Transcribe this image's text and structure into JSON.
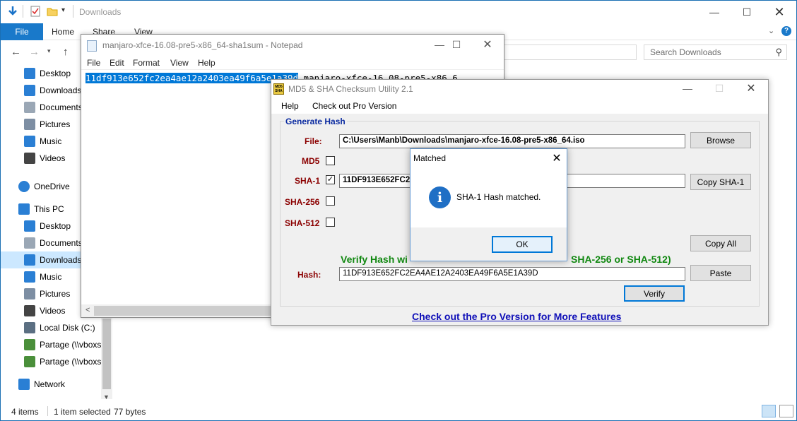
{
  "explorer": {
    "title": "Downloads",
    "ribbon_tabs": {
      "file": "File",
      "home": "Home",
      "share": "Share",
      "view": "View"
    },
    "search_placeholder": "Search Downloads",
    "quick_access": [
      {
        "label": "Desktop",
        "icon": "desktop-icon"
      },
      {
        "label": "Downloads",
        "icon": "download-icon"
      },
      {
        "label": "Documents",
        "icon": "documents-icon"
      },
      {
        "label": "Pictures",
        "icon": "pictures-icon"
      },
      {
        "label": "Music",
        "icon": "music-icon"
      },
      {
        "label": "Videos",
        "icon": "videos-icon"
      }
    ],
    "onedrive": "OneDrive",
    "this_pc": "This PC",
    "this_pc_items": [
      {
        "label": "Desktop",
        "icon": "desktop-icon"
      },
      {
        "label": "Documents",
        "icon": "documents-icon"
      },
      {
        "label": "Downloads",
        "icon": "download-icon",
        "selected": true
      },
      {
        "label": "Music",
        "icon": "music-icon"
      },
      {
        "label": "Pictures",
        "icon": "pictures-icon"
      },
      {
        "label": "Videos",
        "icon": "videos-icon"
      },
      {
        "label": "Local Disk (C:)",
        "icon": "drive-icon"
      },
      {
        "label": "Partage (\\\\vboxs",
        "icon": "network-drive-icon"
      },
      {
        "label": "Partage (\\\\vboxs",
        "icon": "network-drive-icon"
      }
    ],
    "network": "Network",
    "status": {
      "items": "4 items",
      "selected": "1 item selected",
      "size": "77 bytes"
    }
  },
  "notepad": {
    "title": "manjaro-xfce-16.08-pre5-x86_64-sha1sum - Notepad",
    "menu": [
      "File",
      "Edit",
      "Format",
      "View",
      "Help"
    ],
    "selected_text": "11df913e652fc2ea4ae12a2403ea49f6a5e1a39d",
    "rest_text": "  manjaro-xfce-16.08-pre5-x86_6"
  },
  "md5util": {
    "title": "MD5 & SHA Checksum Utility 2.1",
    "logo_text": "MD5 SHA",
    "menu": [
      "Help",
      "Check out Pro Version"
    ],
    "generate_legend": "Generate Hash",
    "file_label": "File:",
    "file_value": "C:\\Users\\Manb\\Downloads\\manjaro-xfce-16.08-pre5-x86_64.iso",
    "browse": "Browse",
    "md5_label": "MD5",
    "sha1_label": "SHA-1",
    "sha1_value": "11DF913E652FC2",
    "sha1_checked": true,
    "copy_sha1": "Copy SHA-1",
    "sha256_label": "SHA-256",
    "sha512_label": "SHA-512",
    "copy_all": "Copy All",
    "verify_heading_start": "Verify Hash wi",
    "verify_heading_end": "SHA-256 or SHA-512)",
    "hash_label": "Hash:",
    "hash_value": "11DF913E652FC2EA4AE12A2403EA49F6A5E1A39D",
    "paste": "Paste",
    "verify": "Verify",
    "pro_link": "Check out the Pro Version for More Features"
  },
  "dialog": {
    "title": "Matched",
    "message": "SHA-1 Hash matched.",
    "ok": "OK",
    "icon": "info-icon"
  },
  "colors": {
    "accent": "#1979ca",
    "selection": "#0078d7",
    "label_red": "#8b0000",
    "verify_green": "#118811",
    "link_blue": "#1010b8"
  }
}
